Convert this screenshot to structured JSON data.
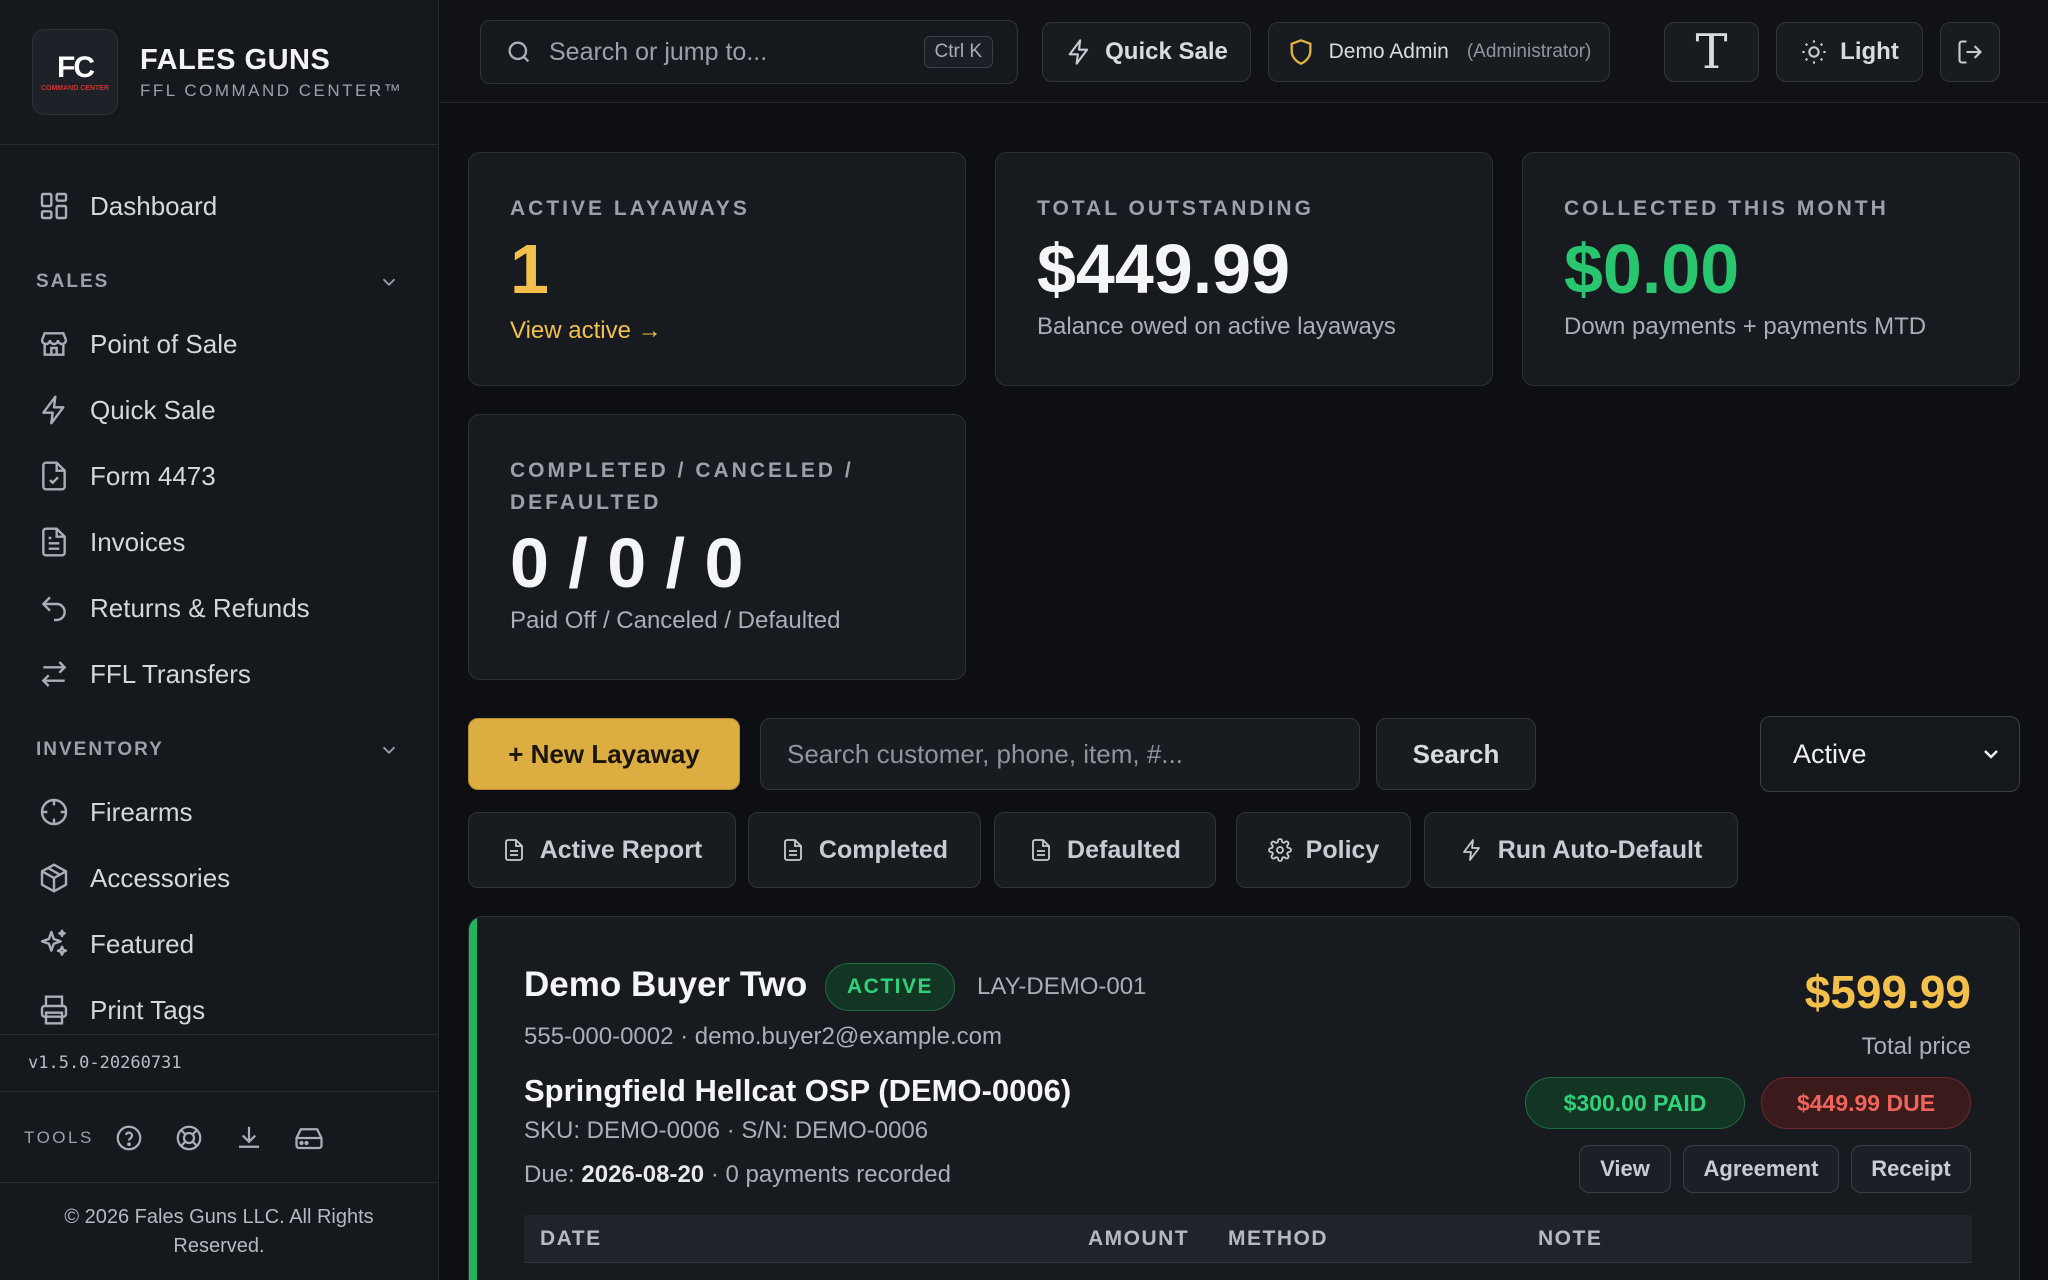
{
  "brand": {
    "logo_letters": "FC",
    "logo_sub": "COMMAND CENTER",
    "name": "FALES GUNS",
    "tagline": "FFL COMMAND CENTER™"
  },
  "sidebar": {
    "dashboard": "Dashboard",
    "sections": [
      {
        "title": "SALES",
        "items": [
          "Point of Sale",
          "Quick Sale",
          "Form 4473",
          "Invoices",
          "Returns & Refunds",
          "FFL Transfers"
        ]
      },
      {
        "title": "INVENTORY",
        "items": [
          "Firearms",
          "Accessories",
          "Featured",
          "Print Tags"
        ]
      }
    ],
    "version": "v1.5.0-20260731",
    "tools_label": "TOOLS",
    "copyright": "© 2026 Fales Guns LLC. All Rights Reserved."
  },
  "topbar": {
    "search_placeholder": "Search or jump to...",
    "shortcut": "Ctrl K",
    "quick_sale": "Quick Sale",
    "user_name": "Demo Admin",
    "user_role": "(Administrator)",
    "font_toggle": "T",
    "theme": "Light"
  },
  "stats": {
    "active": {
      "label": "ACTIVE LAYAWAYS",
      "value": "1",
      "link": "View active →"
    },
    "outstanding": {
      "label": "TOTAL OUTSTANDING",
      "value": "$449.99",
      "sub": "Balance owed on active layaways"
    },
    "collected": {
      "label": "COLLECTED THIS MONTH",
      "value": "$0.00",
      "sub": "Down payments + payments MTD"
    },
    "closed": {
      "label": "COMPLETED / CANCELED / DEFAULTED",
      "value": "0 / 0 / 0",
      "sub": "Paid Off / Canceled / Defaulted"
    }
  },
  "actions": {
    "new_layaway": "+ New Layaway",
    "search_placeholder": "Search customer, phone, item, #...",
    "search_button": "Search",
    "status_selected": "Active",
    "reports": [
      "Active Report",
      "Completed",
      "Defaulted",
      "Policy",
      "Run Auto-Default"
    ]
  },
  "layaway": {
    "customer": "Demo Buyer Two",
    "status": "ACTIVE",
    "id": "LAY-DEMO-001",
    "contact": "555-000-0002 · demo.buyer2@example.com",
    "item": "Springfield Hellcat OSP (DEMO-0006)",
    "sku_line": "SKU: DEMO-0006 · S/N: DEMO-0006",
    "due_label": "Due:",
    "due_date": "2026-08-20",
    "due_tail": "· 0 payments recorded",
    "total_price": "$599.99",
    "total_label": "Total price",
    "paid_badge": "$300.00 PAID",
    "due_badge": "$449.99 DUE",
    "buttons": [
      "View",
      "Agreement",
      "Receipt"
    ],
    "table_headers": [
      "DATE",
      "AMOUNT",
      "METHOD",
      "NOTE"
    ]
  },
  "colors": {
    "accent": "#dcae42",
    "amber_text": "#f3c04c",
    "green": "#28c76f",
    "red": "#f0645c"
  }
}
